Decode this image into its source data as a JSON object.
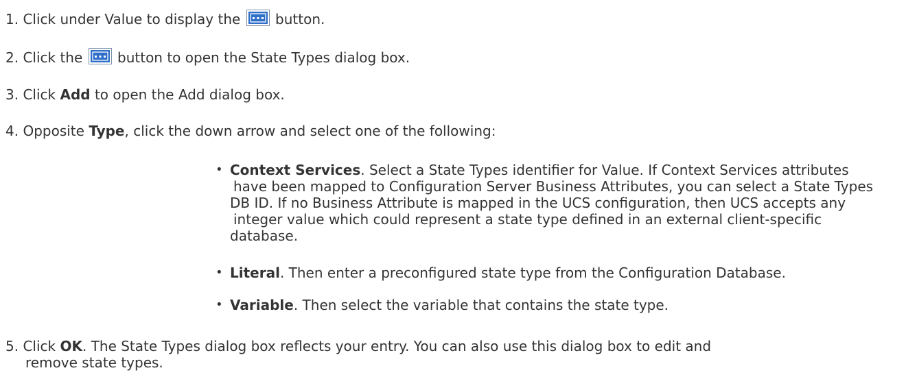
{
  "steps": [
    {
      "num": "1.",
      "pre": "Click under Value to display the",
      "post": "button."
    },
    {
      "num": "2.",
      "pre": "Click the",
      "post": "button to open the State Types dialog box."
    },
    {
      "num": "3.",
      "pre": "Click",
      "bold": "Add",
      "post": "to open the Add dialog box."
    },
    {
      "num": "4.",
      "pre": "Opposite",
      "bold": "Type",
      "post": ", click the down arrow and select one of the following:"
    },
    {
      "num": "5.",
      "pre": "Click",
      "bold": "OK",
      "post": ". The State Types dialog box reflects your entry. You can also use this dialog box to edit and",
      "post2": "remove state types."
    }
  ],
  "options": [
    {
      "bold": "Context Services",
      "lines": [
        ".  Select a State Types identifier for Value. If Context Services attributes",
        "have been mapped to Configuration Server Business Attributes, you can select a State Types",
        "DB ID. If no Business Attribute is mapped in the UCS configuration, then UCS accepts any",
        "integer value which could represent a state type defined in an external client-specific",
        "database."
      ]
    },
    {
      "bold": "Literal",
      "lines": [
        ".  Then enter a preconfigured state type from the Configuration Database."
      ]
    },
    {
      "bold": "Variable",
      "lines": [
        ". Then select the variable that contains the state type."
      ]
    }
  ],
  "icons": {
    "ellipsis_button": "ellipsis-button-icon"
  },
  "colors": {
    "icon_fill": "#2f6fc9",
    "text": "#333333"
  }
}
